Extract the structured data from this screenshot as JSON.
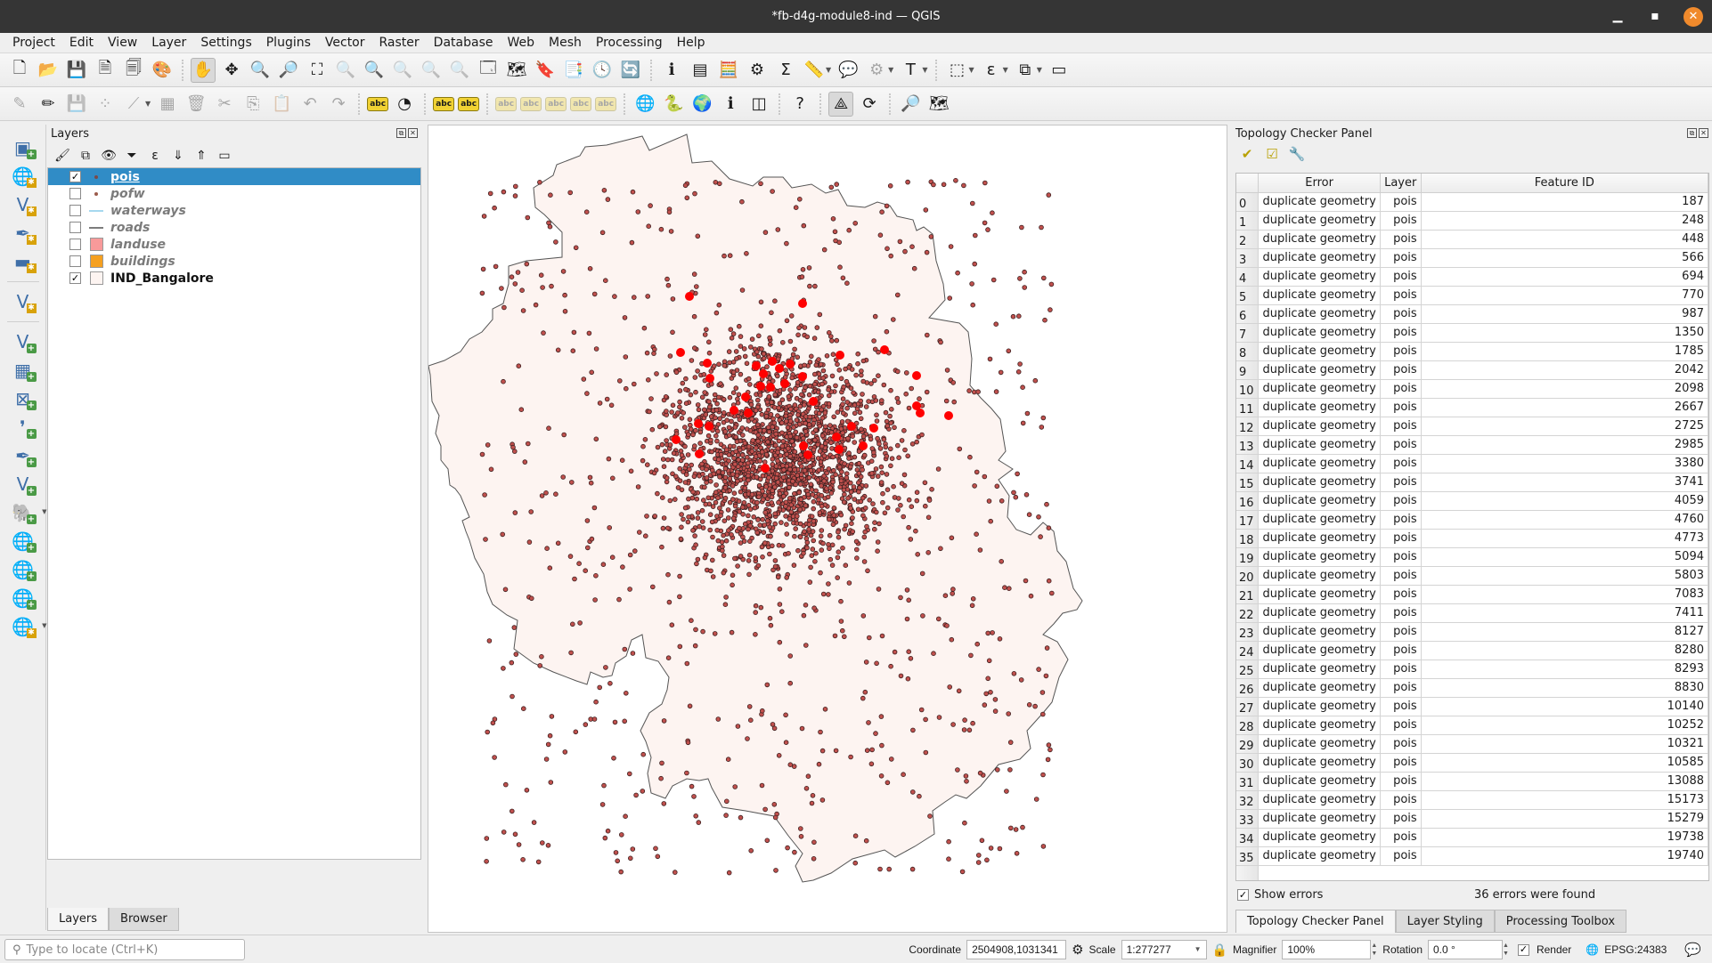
{
  "window": {
    "title": "*fb-d4g-module8-ind — QGIS",
    "minimize": "▁",
    "maximize": "▪",
    "close": "✕"
  },
  "menu": [
    "Project",
    "Edit",
    "View",
    "Layer",
    "Settings",
    "Plugins",
    "Vector",
    "Raster",
    "Database",
    "Web",
    "Mesh",
    "Processing",
    "Help"
  ],
  "toolbar1": [
    {
      "name": "new-project-icon",
      "glyph": "🗋"
    },
    {
      "name": "open-project-icon",
      "glyph": "📂"
    },
    {
      "name": "save-project-icon",
      "glyph": "💾"
    },
    {
      "name": "new-print-layout-icon",
      "glyph": "🗎"
    },
    {
      "name": "layout-manager-icon",
      "glyph": "🗐"
    },
    {
      "name": "style-manager-icon",
      "glyph": "🎨"
    },
    {
      "name": "sep"
    },
    {
      "name": "pan-map-icon",
      "glyph": "✋",
      "active": true
    },
    {
      "name": "pan-to-selection-icon",
      "glyph": "✥"
    },
    {
      "name": "zoom-in-icon",
      "glyph": "🔍"
    },
    {
      "name": "zoom-out-icon",
      "glyph": "🔎"
    },
    {
      "name": "zoom-full-icon",
      "glyph": "⛶"
    },
    {
      "name": "zoom-to-selection-icon",
      "glyph": "🔍",
      "disabled": true
    },
    {
      "name": "zoom-to-layer-icon",
      "glyph": "🔍"
    },
    {
      "name": "zoom-native-icon",
      "glyph": "🔍",
      "disabled": true
    },
    {
      "name": "zoom-last-icon",
      "glyph": "🔍",
      "disabled": true
    },
    {
      "name": "zoom-next-icon",
      "glyph": "🔍",
      "disabled": true
    },
    {
      "name": "new-map-view-icon",
      "glyph": "🗔"
    },
    {
      "name": "new-3d-map-view-icon",
      "glyph": "🗺"
    },
    {
      "name": "new-bookmark-icon",
      "glyph": "🔖"
    },
    {
      "name": "show-bookmarks-icon",
      "glyph": "📑"
    },
    {
      "name": "temporal-controller-icon",
      "glyph": "🕓"
    },
    {
      "name": "refresh-icon",
      "glyph": "🔄"
    },
    {
      "name": "sep"
    },
    {
      "name": "identify-features-icon",
      "glyph": "ℹ"
    },
    {
      "name": "attribute-table-icon",
      "glyph": "▤"
    },
    {
      "name": "field-calculator-icon",
      "glyph": "🧮"
    },
    {
      "name": "processing-toolbox-icon",
      "glyph": "⚙"
    },
    {
      "name": "statistical-summary-icon",
      "glyph": "Σ"
    },
    {
      "name": "measure-line-icon",
      "glyph": "📏",
      "dropdown": true
    },
    {
      "name": "map-tips-icon",
      "glyph": "💬"
    },
    {
      "name": "actions-icon",
      "glyph": "⚙",
      "dropdown": true,
      "disabled": true
    },
    {
      "name": "text-annotation-icon",
      "glyph": "T",
      "dropdown": true
    },
    {
      "name": "sep"
    },
    {
      "name": "select-features-icon",
      "glyph": "⬚",
      "dropdown": true
    },
    {
      "name": "select-by-expression-icon",
      "glyph": "ε",
      "dropdown": true
    },
    {
      "name": "deselect-features-icon",
      "glyph": "⧉",
      "dropdown": true
    },
    {
      "name": "select-by-location-icon",
      "glyph": "▭"
    }
  ],
  "toolbar2": [
    {
      "name": "current-edits-icon",
      "glyph": "✎",
      "disabled": true
    },
    {
      "name": "toggle-editing-icon",
      "glyph": "✏"
    },
    {
      "name": "save-layer-edits-icon",
      "glyph": "💾",
      "disabled": true
    },
    {
      "name": "digitize-point-icon",
      "glyph": "⁘",
      "disabled": true
    },
    {
      "name": "vertex-tool-icon",
      "glyph": "⟋",
      "disabled": true,
      "dropdown": true
    },
    {
      "name": "modify-attributes-icon",
      "glyph": "▦",
      "disabled": true
    },
    {
      "name": "delete-selected-icon",
      "glyph": "🗑",
      "disabled": true
    },
    {
      "name": "cut-features-icon",
      "glyph": "✂",
      "disabled": true
    },
    {
      "name": "copy-features-icon",
      "glyph": "⎘",
      "disabled": true
    },
    {
      "name": "paste-features-icon",
      "glyph": "📋",
      "disabled": true
    },
    {
      "name": "undo-icon",
      "glyph": "↶",
      "disabled": true
    },
    {
      "name": "redo-icon",
      "glyph": "↷",
      "disabled": true
    },
    {
      "name": "sep"
    },
    {
      "name": "layer-labeling-icon",
      "glyph": "abc"
    },
    {
      "name": "layer-diagram-icon",
      "glyph": "◔"
    },
    {
      "name": "sep"
    },
    {
      "name": "pin-labels-icon",
      "glyph": "abc"
    },
    {
      "name": "show-hide-labels-icon",
      "glyph": "abc"
    },
    {
      "name": "sep"
    },
    {
      "name": "move-label-icon",
      "glyph": "abc",
      "disabled": true
    },
    {
      "name": "rotate-label-icon",
      "glyph": "abc",
      "disabled": true
    },
    {
      "name": "change-label-icon",
      "glyph": "abc",
      "disabled": true
    },
    {
      "name": "label-props-icon",
      "glyph": "abc",
      "disabled": true
    },
    {
      "name": "label-edit-icon",
      "glyph": "abc",
      "disabled": true
    },
    {
      "name": "sep"
    },
    {
      "name": "georeferencer-icon",
      "glyph": "🌐"
    },
    {
      "name": "python-console-icon",
      "glyph": "🐍"
    },
    {
      "name": "globe-icon",
      "glyph": "🌍"
    },
    {
      "name": "metasearch-icon",
      "glyph": "ℹ"
    },
    {
      "name": "split-view-icon",
      "glyph": "◫"
    },
    {
      "name": "sep"
    },
    {
      "name": "help-icon",
      "glyph": "?"
    },
    {
      "name": "sep"
    },
    {
      "name": "topology-checker-icon",
      "glyph": "⟁",
      "active": true
    },
    {
      "name": "table-refresh-icon",
      "glyph": "⟳"
    },
    {
      "name": "sep"
    },
    {
      "name": "locator-search-icon",
      "glyph": "🔎"
    },
    {
      "name": "map-tools-icon",
      "glyph": "🗺"
    }
  ],
  "left_toolbar": [
    {
      "name": "data-source-manager-icon",
      "glyph": "▣",
      "badge": "plus"
    },
    {
      "name": "new-geopackage-layer-icon",
      "glyph": "🌐",
      "badge": "star"
    },
    {
      "name": "new-shapefile-layer-icon",
      "glyph": "V",
      "badge": "star"
    },
    {
      "name": "new-scratch-layer-icon",
      "glyph": "✒",
      "badge": "star"
    },
    {
      "name": "new-virtual-layer-icon",
      "glyph": "▬",
      "badge": "star"
    },
    {
      "name": "sep"
    },
    {
      "name": "new-mesh-layer-icon",
      "glyph": "V",
      "badge": "star"
    },
    {
      "name": "sep"
    },
    {
      "name": "add-vector-layer-icon",
      "glyph": "V",
      "badge": "plus"
    },
    {
      "name": "add-raster-layer-icon",
      "glyph": "▦",
      "badge": "plus"
    },
    {
      "name": "add-mesh-layer-icon",
      "glyph": "⊠",
      "badge": "plus"
    },
    {
      "name": "add-delimited-text-icon",
      "glyph": "❜",
      "badge": "plus"
    },
    {
      "name": "add-spatialite-layer-icon",
      "glyph": "✒",
      "badge": "plus"
    },
    {
      "name": "add-virtual-layer-icon",
      "glyph": "V",
      "badge": "plus"
    },
    {
      "name": "add-postgis-layer-icon",
      "glyph": "🐘",
      "badge": "plus",
      "dropdown": true
    },
    {
      "name": "add-wms-layer-icon",
      "glyph": "🌐",
      "badge": "plus"
    },
    {
      "name": "add-wcs-layer-icon",
      "glyph": "🌐",
      "badge": "plus"
    },
    {
      "name": "add-wfs-layer-icon",
      "glyph": "🌐",
      "badge": "plus"
    },
    {
      "name": "new-layer-icon",
      "glyph": "🌐",
      "badge": "star",
      "dropdown": true
    }
  ],
  "layers_panel": {
    "title": "Layers",
    "tools": [
      {
        "name": "open-layer-styling-icon",
        "glyph": "🖌"
      },
      {
        "name": "add-group-icon",
        "glyph": "⧉"
      },
      {
        "name": "manage-visibility-icon",
        "glyph": "👁"
      },
      {
        "name": "filter-legend-icon",
        "glyph": "⏷"
      },
      {
        "name": "filter-by-expression-icon",
        "glyph": "ε"
      },
      {
        "name": "expand-all-icon",
        "glyph": "⇓"
      },
      {
        "name": "collapse-all-icon",
        "glyph": "⇑"
      },
      {
        "name": "remove-layer-icon",
        "glyph": "▭"
      }
    ],
    "layers": [
      {
        "name": "pois",
        "checked": true,
        "selected": true,
        "symbol": "point",
        "color": "#7a4a4a",
        "visible_style": "on"
      },
      {
        "name": "pofw",
        "checked": false,
        "symbol": "point",
        "color": "#9b5b4b"
      },
      {
        "name": "waterways",
        "checked": false,
        "symbol": "line",
        "color": "#a6d8ef"
      },
      {
        "name": "roads",
        "checked": false,
        "symbol": "line",
        "color": "#7c7c7c"
      },
      {
        "name": "landuse",
        "checked": false,
        "symbol": "fill",
        "color": "#f89a9a"
      },
      {
        "name": "buildings",
        "checked": false,
        "symbol": "fill",
        "color": "#f5a020"
      },
      {
        "name": "IND_Bangalore",
        "checked": true,
        "symbol": "fill",
        "color": "#fdf4f1",
        "visible_style": "on"
      }
    ],
    "tabs": [
      {
        "label": "Layers",
        "active": true
      },
      {
        "label": "Browser",
        "active": false
      }
    ]
  },
  "map": {
    "background": "#ffffff",
    "boundary_fill": "#fdf4f1",
    "point_color": "#c0504d",
    "point_stroke": "#3b1f1f",
    "error_color": "#ff0000",
    "error_points_count": 36
  },
  "topology_panel": {
    "title": "Topology Checker Panel",
    "tools": [
      {
        "name": "validate-all-icon",
        "glyph": "✔"
      },
      {
        "name": "validate-extent-icon",
        "glyph": "☑"
      },
      {
        "name": "configure-rules-icon",
        "glyph": "🔧"
      }
    ],
    "columns": [
      "Error",
      "Layer",
      "Feature ID"
    ],
    "rows": [
      {
        "error": "duplicate geometry",
        "layer": "pois",
        "fid": "187"
      },
      {
        "error": "duplicate geometry",
        "layer": "pois",
        "fid": "248"
      },
      {
        "error": "duplicate geometry",
        "layer": "pois",
        "fid": "448"
      },
      {
        "error": "duplicate geometry",
        "layer": "pois",
        "fid": "566"
      },
      {
        "error": "duplicate geometry",
        "layer": "pois",
        "fid": "694"
      },
      {
        "error": "duplicate geometry",
        "layer": "pois",
        "fid": "770"
      },
      {
        "error": "duplicate geometry",
        "layer": "pois",
        "fid": "987"
      },
      {
        "error": "duplicate geometry",
        "layer": "pois",
        "fid": "1350"
      },
      {
        "error": "duplicate geometry",
        "layer": "pois",
        "fid": "1785"
      },
      {
        "error": "duplicate geometry",
        "layer": "pois",
        "fid": "2042"
      },
      {
        "error": "duplicate geometry",
        "layer": "pois",
        "fid": "2098"
      },
      {
        "error": "duplicate geometry",
        "layer": "pois",
        "fid": "2667"
      },
      {
        "error": "duplicate geometry",
        "layer": "pois",
        "fid": "2725"
      },
      {
        "error": "duplicate geometry",
        "layer": "pois",
        "fid": "2985"
      },
      {
        "error": "duplicate geometry",
        "layer": "pois",
        "fid": "3380"
      },
      {
        "error": "duplicate geometry",
        "layer": "pois",
        "fid": "3741"
      },
      {
        "error": "duplicate geometry",
        "layer": "pois",
        "fid": "4059"
      },
      {
        "error": "duplicate geometry",
        "layer": "pois",
        "fid": "4760"
      },
      {
        "error": "duplicate geometry",
        "layer": "pois",
        "fid": "4773"
      },
      {
        "error": "duplicate geometry",
        "layer": "pois",
        "fid": "5094"
      },
      {
        "error": "duplicate geometry",
        "layer": "pois",
        "fid": "5803"
      },
      {
        "error": "duplicate geometry",
        "layer": "pois",
        "fid": "7083"
      },
      {
        "error": "duplicate geometry",
        "layer": "pois",
        "fid": "7411"
      },
      {
        "error": "duplicate geometry",
        "layer": "pois",
        "fid": "8127"
      },
      {
        "error": "duplicate geometry",
        "layer": "pois",
        "fid": "8280"
      },
      {
        "error": "duplicate geometry",
        "layer": "pois",
        "fid": "8293"
      },
      {
        "error": "duplicate geometry",
        "layer": "pois",
        "fid": "8830"
      },
      {
        "error": "duplicate geometry",
        "layer": "pois",
        "fid": "10140"
      },
      {
        "error": "duplicate geometry",
        "layer": "pois",
        "fid": "10252"
      },
      {
        "error": "duplicate geometry",
        "layer": "pois",
        "fid": "10321"
      },
      {
        "error": "duplicate geometry",
        "layer": "pois",
        "fid": "10585"
      },
      {
        "error": "duplicate geometry",
        "layer": "pois",
        "fid": "13088"
      },
      {
        "error": "duplicate geometry",
        "layer": "pois",
        "fid": "15173"
      },
      {
        "error": "duplicate geometry",
        "layer": "pois",
        "fid": "15279"
      },
      {
        "error": "duplicate geometry",
        "layer": "pois",
        "fid": "19738"
      },
      {
        "error": "duplicate geometry",
        "layer": "pois",
        "fid": "19740"
      }
    ],
    "show_errors_label": "Show errors",
    "show_errors_checked": true,
    "error_summary": "36 errors were found",
    "tabs": [
      {
        "label": "Topology Checker Panel",
        "active": true
      },
      {
        "label": "Layer Styling",
        "active": false
      },
      {
        "label": "Processing Toolbox",
        "active": false
      }
    ]
  },
  "statusbar": {
    "locator_placeholder": "Type to locate (Ctrl+K)",
    "coordinate_label": "Coordinate",
    "coordinate_value": "2504908,1031341",
    "scale_label": "Scale",
    "scale_value": "1:277277",
    "magnifier_label": "Magnifier",
    "magnifier_value": "100%",
    "rotation_label": "Rotation",
    "rotation_value": "0.0 °",
    "render_label": "Render",
    "render_checked": true,
    "crs": "EPSG:24383"
  }
}
